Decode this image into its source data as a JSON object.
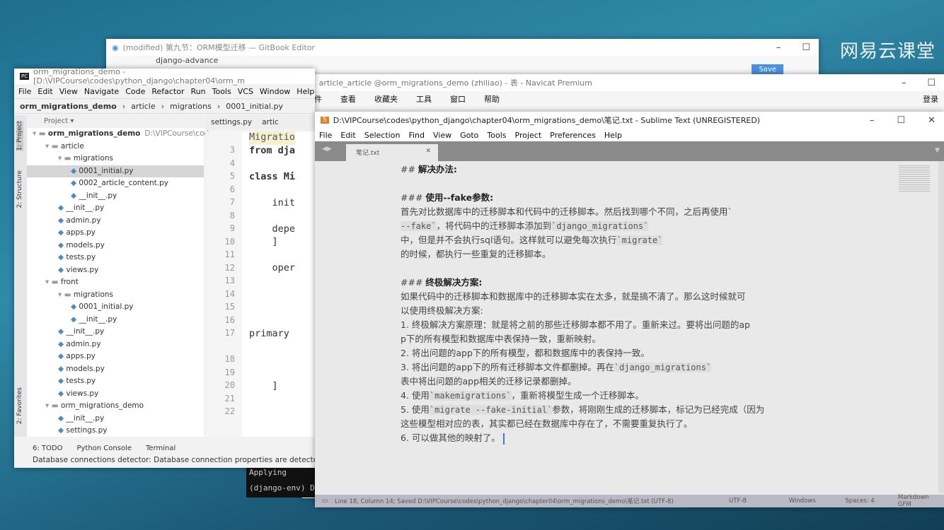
{
  "brand": "网易云课堂",
  "gitbook": {
    "title": "(modified) 第九节：ORM模型迁移 — GitBook Editor",
    "tab": "django-advance",
    "save": "Save"
  },
  "pycharm": {
    "title": "orm_migrations_demo - [D:\\VIPCourse\\codes\\python_django\\chapter04\\orm_m",
    "menu": [
      "File",
      "Edit",
      "View",
      "Navigate",
      "Code",
      "Refactor",
      "Run",
      "Tools",
      "VCS",
      "Window",
      "Help"
    ],
    "breadcrumb": [
      "orm_migrations_demo",
      "article",
      "migrations",
      "0001_initial.py"
    ],
    "project_label": "Project",
    "tabs": [
      "settings.py",
      "artic"
    ],
    "side_tabs": [
      "1: Project",
      "2: Structure",
      "2: Favorites"
    ],
    "tree": [
      {
        "t": "orm_migrations_demo",
        "extra": "D:\\VIPCourse\\codes",
        "d": 0,
        "f": 1
      },
      {
        "t": "article",
        "d": 1,
        "f": 1
      },
      {
        "t": "migrations",
        "d": 2,
        "f": 1
      },
      {
        "t": "0001_initial.py",
        "d": 3
      },
      {
        "t": "0002_article_content.py",
        "d": 3
      },
      {
        "t": "__init__.py",
        "d": 3
      },
      {
        "t": "__init__.py",
        "d": 2
      },
      {
        "t": "admin.py",
        "d": 2
      },
      {
        "t": "apps.py",
        "d": 2
      },
      {
        "t": "models.py",
        "d": 2
      },
      {
        "t": "tests.py",
        "d": 2
      },
      {
        "t": "views.py",
        "d": 2
      },
      {
        "t": "front",
        "d": 1,
        "f": 1
      },
      {
        "t": "migrations",
        "d": 2,
        "f": 1
      },
      {
        "t": "0001_initial.py",
        "d": 3
      },
      {
        "t": "__init__.py",
        "d": 3
      },
      {
        "t": "__init__.py",
        "d": 2
      },
      {
        "t": "admin.py",
        "d": 2
      },
      {
        "t": "apps.py",
        "d": 2
      },
      {
        "t": "models.py",
        "d": 2
      },
      {
        "t": "tests.py",
        "d": 2
      },
      {
        "t": "views.py",
        "d": 2
      },
      {
        "t": "orm_migrations_demo",
        "d": 1,
        "f": 1
      },
      {
        "t": "__init__.py",
        "d": 2
      },
      {
        "t": "settings.py",
        "d": 2
      }
    ],
    "line_numbers": [
      "3",
      "4",
      "5",
      "6",
      "7",
      "8",
      "9",
      "10",
      "11",
      "12",
      "13",
      "14",
      "15",
      "16",
      "17",
      "",
      "18",
      "19",
      "20",
      "21",
      "22"
    ],
    "code": [
      "Migratio",
      "from dja",
      "",
      "class Mi",
      "",
      "    init",
      "",
      "    depe",
      "    ]",
      "",
      "    oper",
      "",
      "",
      "",
      "",
      "primary",
      "",
      "",
      "",
      "    ]",
      ""
    ],
    "bottom_tabs": [
      "6: TODO",
      "Python Console",
      "Terminal"
    ],
    "status": "Database connections detector: Database connection properties are detected.",
    "terminal": [
      "Applying",
      "(django-env) D"
    ]
  },
  "navicat": {
    "title": "article_article @orm_migrations_demo (zhiliao) - 表 - Navicat Premium",
    "menu": [
      "文件",
      "查看",
      "收藏夹",
      "工具",
      "窗口",
      "帮助"
    ],
    "login": "登录"
  },
  "sublime": {
    "title": "D:\\VIPCourse\\codes\\python_django\\chapter04\\orm_migrations_demo\\笔记.txt - Sublime Text (UNREGISTERED)",
    "menu": [
      "File",
      "Edit",
      "Selection",
      "Find",
      "View",
      "Goto",
      "Tools",
      "Project",
      "Preferences",
      "Help"
    ],
    "tab": "笔记.txt",
    "lines": [
      {
        "p": "## ",
        "b": "解决办法:"
      },
      {},
      {
        "p": "### ",
        "b": "使用--fake参数:"
      },
      {
        "t": "首先对比数据库中的迁移脚本和代码中的迁移脚本。然后找到哪个不同，之后再使用`"
      },
      {
        "c": "--fake`",
        "t": "，将代码中的迁移脚本添加到",
        "c2": "`django_migrations`"
      },
      {
        "t": "中，但是并不会执行sql语句。这样就可以避免每次执行",
        "c2": "`migrate`"
      },
      {
        "t": "的时候，都执行一些重复的迁移脚本。"
      },
      {},
      {
        "p": "### ",
        "b": "终极解决方案:"
      },
      {
        "t": "如果代码中的迁移脚本和数据库中的迁移脚本实在太多，就是搞不清了。那么这时候就可"
      },
      {
        "t": "以使用终极解决方案:"
      },
      {
        "t": "1. 终极解决方案原理：就是将之前的那些迁移脚本都不用了。重新来过。要将出问题的ap"
      },
      {
        "t": "p下的所有模型和数据库中表保持一致，重新映射。"
      },
      {
        "t": "2. 将出问题的app下的所有模型，都和数据库中的表保持一致。"
      },
      {
        "t": "3. 将出问题的app下的所有迁移脚本文件都删掉。再在",
        "c2": "`django_migrations`"
      },
      {
        "t": "表中将出问题的app相关的迁移记录都删掉。"
      },
      {
        "t": "4. 使用",
        "c": "`makemigrations`",
        "t2": "，重新将模型生成一个迁移脚本。"
      },
      {
        "t": "5. 使用",
        "c": "`migrate --fake-initial`",
        "t2": "参数，将刚刚生成的迁移脚本，标记为已经完成（因为"
      },
      {
        "t": "这些模型相对应的表，其实都已经在数据库中存在了，不需要重复执行了。"
      },
      {
        "t": "6. 可以做其他的映射了。"
      }
    ],
    "status": {
      "left": "Line 18, Column 14; Saved D:\\VIPCourse\\codes\\python_django\\chapter04\\orm_migrations_demo\\笔记.txt (UTF-8)",
      "encoding": "UTF-8",
      "line_endings": "Windows",
      "indent": "Spaces: 4",
      "syntax": "Markdown GFM"
    }
  }
}
